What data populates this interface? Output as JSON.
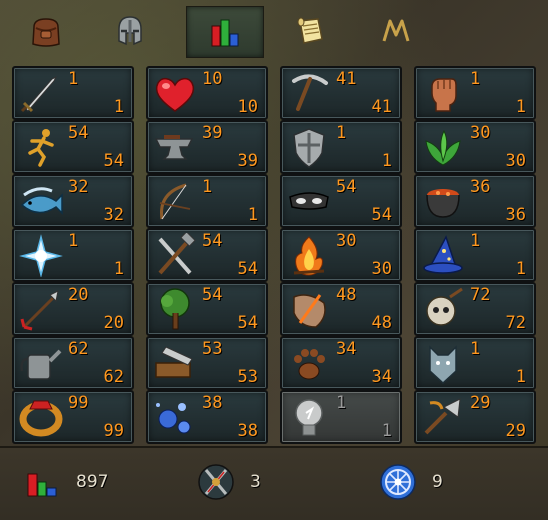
{
  "tabs": [
    {
      "name": "inventory-tab",
      "icon": "backpack-icon"
    },
    {
      "name": "equipment-tab",
      "icon": "helmet-icon"
    },
    {
      "name": "stats-tab",
      "icon": "stats-icon",
      "active": true
    },
    {
      "name": "quests-tab",
      "icon": "scroll-icon"
    },
    {
      "name": "achievements-tab",
      "icon": "m-icon"
    }
  ],
  "skills": [
    {
      "name": "attack",
      "icon": "sword-icon",
      "level": "1",
      "base": "1"
    },
    {
      "name": "constitution",
      "icon": "heart-icon",
      "level": "10",
      "base": "10"
    },
    {
      "name": "mining",
      "icon": "pickaxe-icon",
      "level": "41",
      "base": "41"
    },
    {
      "name": "strength",
      "icon": "fist-icon",
      "level": "1",
      "base": "1"
    },
    {
      "name": "agility",
      "icon": "running-man-icon",
      "level": "54",
      "base": "54"
    },
    {
      "name": "smithing",
      "icon": "anvil-icon",
      "level": "39",
      "base": "39"
    },
    {
      "name": "defence",
      "icon": "shield-icon",
      "level": "1",
      "base": "1"
    },
    {
      "name": "herblore",
      "icon": "herb-icon",
      "level": "30",
      "base": "30"
    },
    {
      "name": "fishing",
      "icon": "fish-icon",
      "level": "32",
      "base": "32"
    },
    {
      "name": "ranged",
      "icon": "bow-icon",
      "level": "1",
      "base": "1"
    },
    {
      "name": "thieving",
      "icon": "mask-icon",
      "level": "54",
      "base": "54"
    },
    {
      "name": "cooking",
      "icon": "cauldron-icon",
      "level": "36",
      "base": "36"
    },
    {
      "name": "prayer",
      "icon": "star-icon",
      "level": "1",
      "base": "1"
    },
    {
      "name": "crafting",
      "icon": "hammer-chisel-icon",
      "level": "54",
      "base": "54"
    },
    {
      "name": "firemaking",
      "icon": "fire-icon",
      "level": "30",
      "base": "30"
    },
    {
      "name": "magic",
      "icon": "wizard-hat-icon",
      "level": "1",
      "base": "1"
    },
    {
      "name": "fletching",
      "icon": "arrow-icon",
      "level": "20",
      "base": "20"
    },
    {
      "name": "woodcutting",
      "icon": "tree-icon",
      "level": "54",
      "base": "54"
    },
    {
      "name": "runecrafting",
      "icon": "rune-icon",
      "level": "48",
      "base": "48"
    },
    {
      "name": "slayer",
      "icon": "skull-icon",
      "level": "72",
      "base": "72"
    },
    {
      "name": "farming",
      "icon": "watering-can-icon",
      "level": "62",
      "base": "62"
    },
    {
      "name": "construction",
      "icon": "saw-plank-icon",
      "level": "53",
      "base": "53"
    },
    {
      "name": "hunter",
      "icon": "paw-icon",
      "level": "34",
      "base": "34"
    },
    {
      "name": "summoning",
      "icon": "wolf-pouch-icon",
      "level": "1",
      "base": "1"
    },
    {
      "name": "dungeoneering",
      "icon": "ring-icon",
      "level": "99",
      "base": "99"
    },
    {
      "name": "divination",
      "icon": "orbs-icon",
      "level": "38",
      "base": "38"
    },
    {
      "name": "invention",
      "icon": "bulb-icon",
      "level": "1",
      "base": "1",
      "dim": true
    },
    {
      "name": "archaeology",
      "icon": "trowel-icon",
      "level": "29",
      "base": "29"
    }
  ],
  "footer": {
    "total_level": "897",
    "combat_level": "3",
    "third_value": "9"
  },
  "colors": {
    "level": "#ff981f",
    "panel": "#1c2628",
    "dim_level": "#9a9a9a"
  }
}
